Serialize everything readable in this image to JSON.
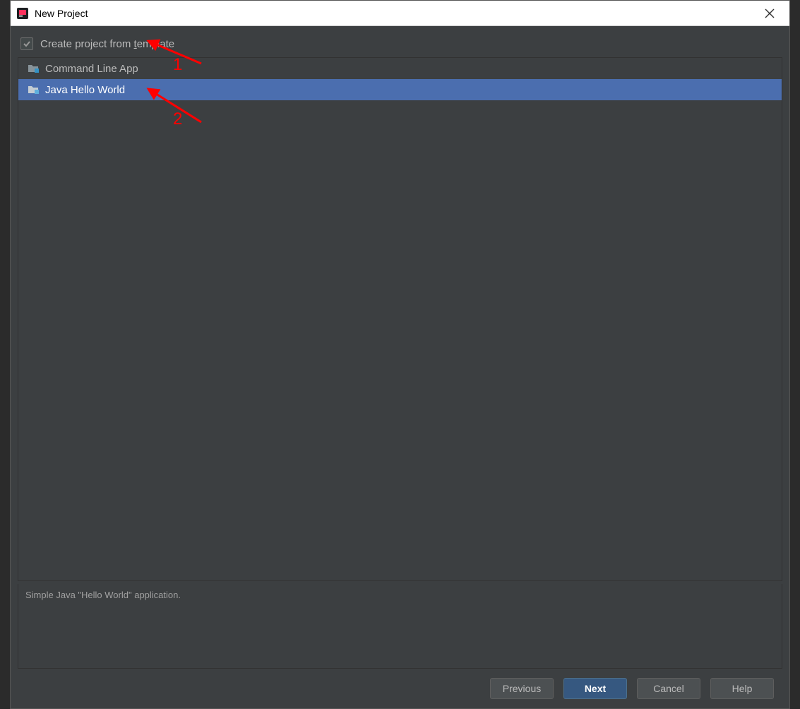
{
  "window": {
    "title": "New Project"
  },
  "checkbox": {
    "label_prefix": "Create project from ",
    "label_mnemonic": "t",
    "label_suffix": "emplate",
    "checked": true
  },
  "templates": [
    {
      "label": "Command Line App",
      "selected": false
    },
    {
      "label": "Java Hello World",
      "selected": true
    }
  ],
  "description": "Simple Java \"Hello World\" application.",
  "buttons": {
    "previous": "Previous",
    "next": "Next",
    "cancel": "Cancel",
    "help": "Help"
  },
  "annotations": {
    "label1": "1",
    "label2": "2"
  }
}
